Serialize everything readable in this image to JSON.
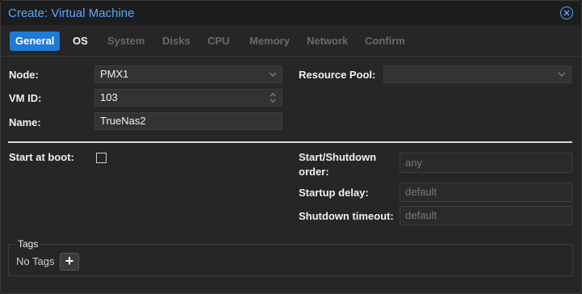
{
  "window": {
    "title": "Create: Virtual Machine"
  },
  "tabs": [
    {
      "label": "General"
    },
    {
      "label": "OS"
    },
    {
      "label": "System"
    },
    {
      "label": "Disks"
    },
    {
      "label": "CPU"
    },
    {
      "label": "Memory"
    },
    {
      "label": "Network"
    },
    {
      "label": "Confirm"
    }
  ],
  "form": {
    "node_label": "Node:",
    "node_value": "PMX1",
    "vmid_label": "VM ID:",
    "vmid_value": "103",
    "name_label": "Name:",
    "name_value": "TrueNas2",
    "resource_pool_label": "Resource Pool:",
    "resource_pool_value": "",
    "start_at_boot_label": "Start at boot:",
    "start_at_boot_checked": false,
    "start_shutdown_label_1": "Start/Shutdown",
    "start_shutdown_label_2": "order:",
    "start_shutdown_placeholder": "any",
    "startup_delay_label": "Startup delay:",
    "startup_delay_placeholder": "default",
    "shutdown_timeout_label": "Shutdown timeout:",
    "shutdown_timeout_placeholder": "default"
  },
  "tags": {
    "legend": "Tags",
    "empty_text": "No Tags",
    "add_symbol": "+"
  },
  "colors": {
    "accent": "#1e7ad4",
    "title": "#56a7ff"
  },
  "icons": {
    "close": "close-circle-icon",
    "dropdown": "chevron-down-icon",
    "spinner": "spinner-updown-icon",
    "add": "plus-icon"
  }
}
